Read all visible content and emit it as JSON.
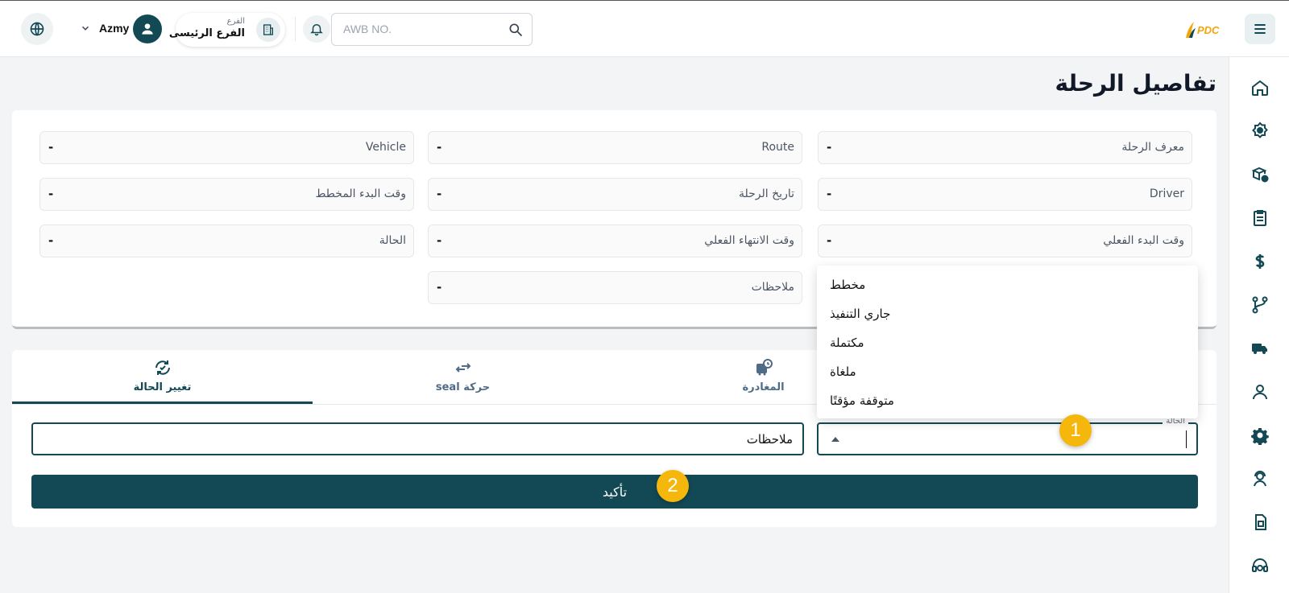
{
  "header": {
    "user_name": "Azmy",
    "branch_caption": "الفرع",
    "branch_name": "الفرع الرئيسى",
    "search_placeholder": "AWB NO.",
    "logo_text": "PDC"
  },
  "page": {
    "title": "تفاصيل الرحلة"
  },
  "details": {
    "trip_id_label": "معرف الرحلة",
    "trip_id_value": "-",
    "route_label": "Route",
    "route_value": "-",
    "vehicle_label": "Vehicle",
    "vehicle_value": "-",
    "driver_label": "Driver",
    "driver_value": "-",
    "trip_date_label": "تاريخ الرحلة",
    "trip_date_value": "-",
    "planned_start_label": "وقت البدء المخطط",
    "planned_start_value": "-",
    "actual_start_label": "وقت البدء الفعلي",
    "actual_start_value": "-",
    "actual_end_label": "وقت الانتهاء الفعلي",
    "actual_end_value": "-",
    "status_label": "الحالة",
    "status_value": "-",
    "notes_label": "ملاحظات",
    "notes_value": "-"
  },
  "tabs": [
    {
      "label": "تغيير الحالة",
      "active": true
    },
    {
      "label": "حركة seal",
      "active": false
    },
    {
      "label": "المغادرة",
      "active": false
    }
  ],
  "form": {
    "notes_placeholder": "ملاحظات",
    "status_field_label": "الحالة",
    "confirm_label": "تأكيد"
  },
  "status_options": [
    "مخطط",
    "جاري التنفيذ",
    "مكتملة",
    "ملغاة",
    "متوقفة مؤقتًا"
  ],
  "badges": {
    "first": "1",
    "second": "2"
  },
  "colors": {
    "primary": "#124955",
    "badge": "#f5b70c",
    "logo_orange": "#f5a50c"
  }
}
